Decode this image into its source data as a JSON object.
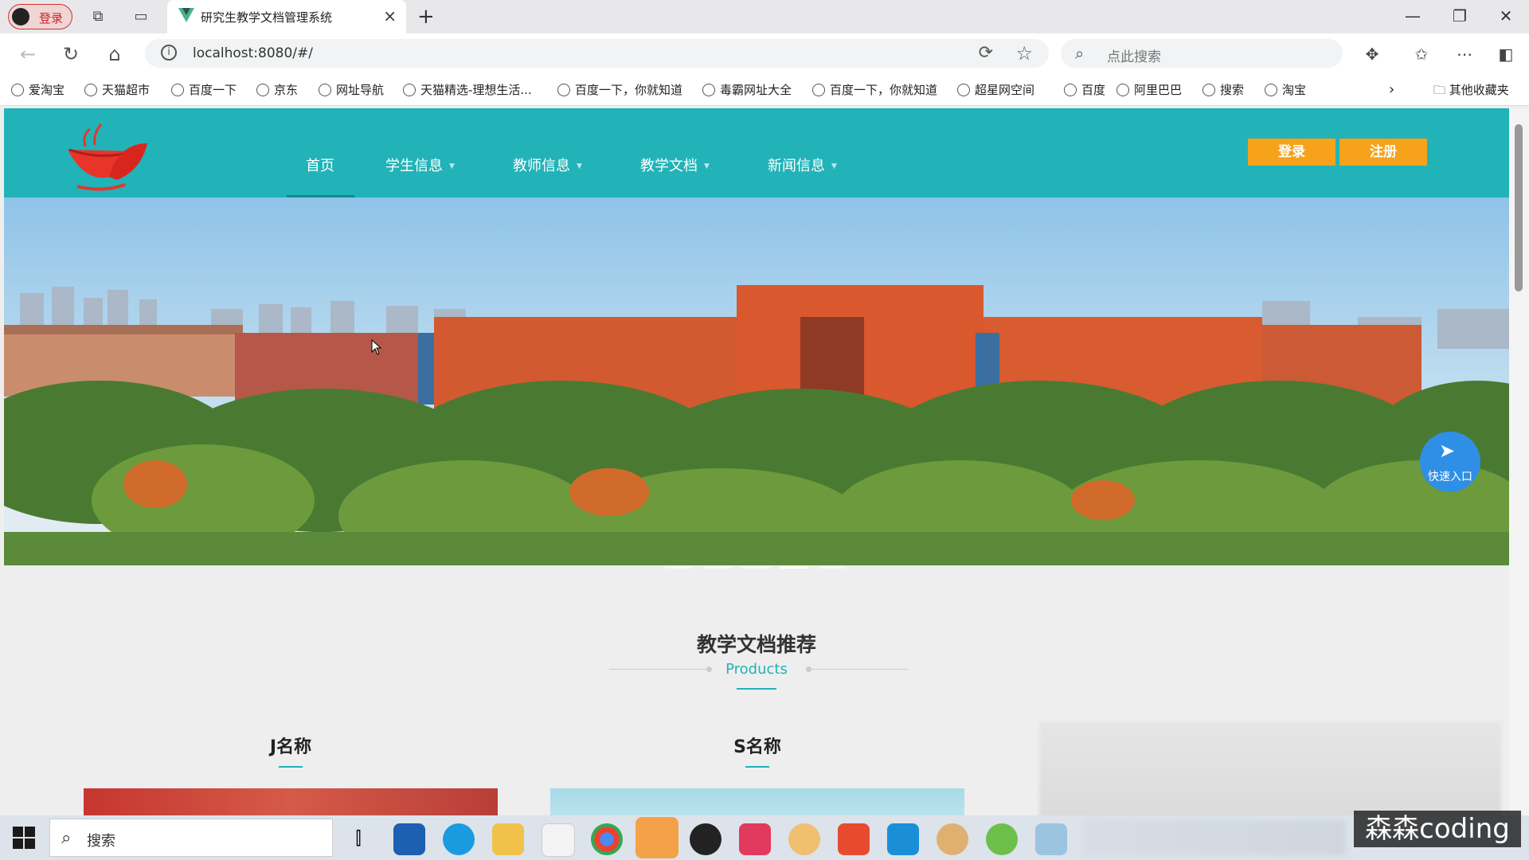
{
  "browser": {
    "profile_label": "登录",
    "tab_title": "研究生教学文档管理系统",
    "url": "localhost:8080/#/",
    "search_placeholder": "点此搜索",
    "bookmarks": [
      "爱淘宝",
      "天猫超市",
      "百度一下",
      "京东",
      "网址导航",
      "天猫精选-理想生活...",
      "百度一下，你就知道",
      "毒霸网址大全",
      "百度一下，你就知道",
      "超星网空间",
      "百度",
      "阿里巴巴",
      "搜索",
      "淘宝"
    ],
    "other_bookmarks": "其他收藏夹"
  },
  "site": {
    "nav": [
      {
        "label": "首页",
        "dropdown": false
      },
      {
        "label": "学生信息",
        "dropdown": true
      },
      {
        "label": "教师信息",
        "dropdown": true
      },
      {
        "label": "教学文档",
        "dropdown": true
      },
      {
        "label": "新闻信息",
        "dropdown": true
      }
    ],
    "login_label": "登录",
    "register_label": "注册",
    "banner": {
      "slides": 5,
      "active_slide": 4
    },
    "quick_entry_label": "快速入口",
    "section_title": "教学文档推荐",
    "section_subtitle": "Products",
    "products": [
      {
        "name": "J名称"
      },
      {
        "name": "S名称"
      }
    ]
  },
  "taskbar": {
    "search_placeholder": "搜索",
    "watermark": "森森coding"
  },
  "colors": {
    "header": "#21b3b8",
    "accent": "#f7a21b",
    "quick_entry": "#2f8fe6"
  }
}
